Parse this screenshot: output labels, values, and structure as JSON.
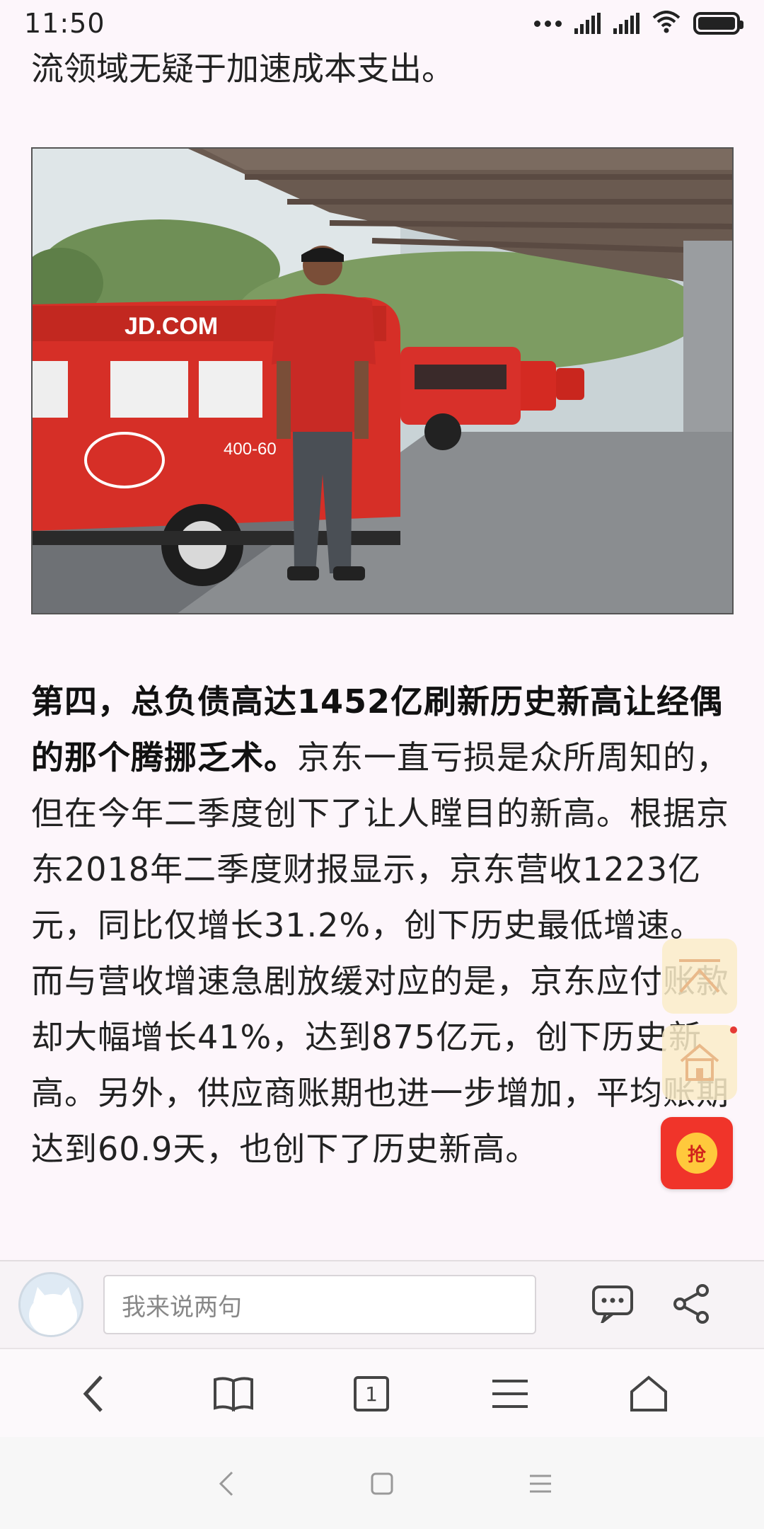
{
  "status_bar": {
    "time": "11:50"
  },
  "article": {
    "prev_line": "流领域无疑于加速成本支出。",
    "photo": {
      "van_logo": "JD.COM",
      "van_phone": "400-60"
    },
    "para_bold": "第四，总负债高达1452亿刷新历史新高让经偶的那个腾挪乏术。",
    "para_text": "京东一直亏损是众所周知的，但在今年二季度创下了让人瞠目的新高。根据京东2018年二季度财报显示，京东营收1223亿元，同比仅增长31.2%，创下历史最低增速。而与营收增速急剧放缓对应的是，京东应付账款却大幅增长41%，达到875亿元，创下历史新高。另外，供应商账期也进一步增加，平均账期达到60.9天，也创下了历史新高。"
  },
  "floating": {
    "red_button_label": "抢"
  },
  "comment_bar": {
    "input_placeholder": "我来说两句"
  },
  "browser_nav": {
    "tab_count": "1"
  }
}
